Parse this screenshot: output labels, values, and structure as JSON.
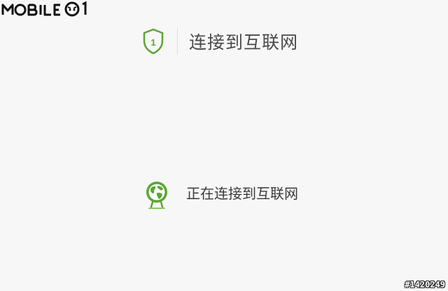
{
  "watermark": {
    "logo_text": "MOBILE01",
    "image_id": "#1420249"
  },
  "step": {
    "number": "1",
    "title": "连接到互联网",
    "icon": "shield-icon"
  },
  "status": {
    "text": "正在连接到互联网",
    "icon": "globe-icon"
  },
  "colors": {
    "accent_green": "#5aa532",
    "background": "#f7f7f7",
    "text": "#4a4a4a"
  }
}
